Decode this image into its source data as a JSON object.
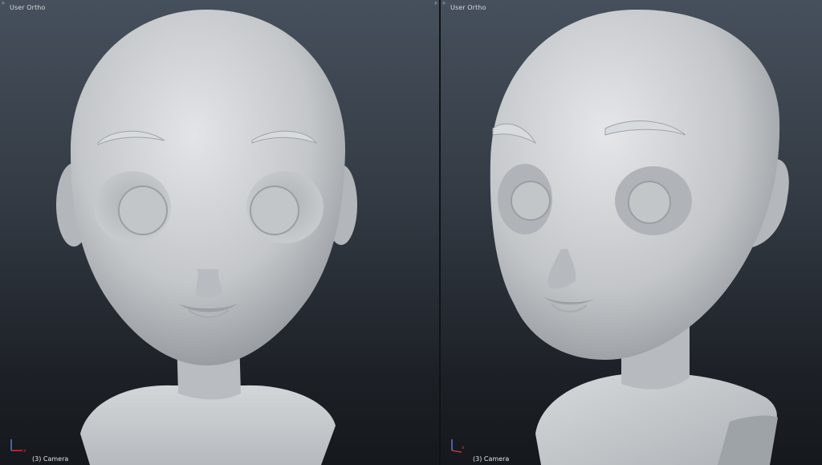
{
  "viewports": [
    {
      "id": "front",
      "title": "User Ortho",
      "camera_label": "(3) Camera",
      "axis_labels": {
        "x": "x",
        "y": "y"
      }
    },
    {
      "id": "angle",
      "title": "User Ortho",
      "camera_label": "(3) Camera",
      "axis_labels": {
        "x": "x",
        "y": "y"
      }
    }
  ],
  "colors": {
    "skin": "#bfc3c7",
    "bg_top": "#46505c",
    "bg_bottom": "#15181c",
    "axis_x": "#cc3333",
    "axis_y": "#5577dd",
    "text": "#d6d9dd"
  }
}
